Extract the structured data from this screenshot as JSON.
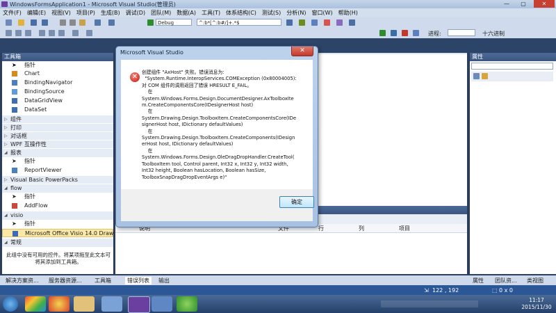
{
  "window": {
    "title": "WindowsFormsApplication1 - Microsoft Visual Studio(管理员)",
    "minimize": "—",
    "maximize": "▢",
    "close": "✕"
  },
  "menu": [
    "文件(F)",
    "编辑(E)",
    "视图(V)",
    "项目(P)",
    "生成(B)",
    "调试(D)",
    "团队(M)",
    "数据(A)",
    "工具(T)",
    "体系结构(C)",
    "测试(S)",
    "分析(N)",
    "窗口(W)",
    "帮助(H)"
  ],
  "toolbar": {
    "config": "Debug",
    "find": "^:b*[^:b#/]+.*$",
    "hex": "十六进制",
    "progress": "进程:"
  },
  "toolbox": {
    "title": "工具箱",
    "items": [
      {
        "label": "指针",
        "icon": "pointer-icon"
      },
      {
        "label": "Chart",
        "icon": "chart-icon"
      },
      {
        "label": "BindingNavigator",
        "icon": "binding-navigator-icon"
      },
      {
        "label": "BindingSource",
        "icon": "binding-source-icon"
      },
      {
        "label": "DataGridView",
        "icon": "datagridview-icon"
      },
      {
        "label": "DataSet",
        "icon": "dataset-icon"
      }
    ],
    "groups_collapsed": [
      "组件",
      "打印",
      "对话框",
      "WPF 互操作性"
    ],
    "report_group": "报表",
    "report_items": [
      "指针",
      "ReportViewer"
    ],
    "vb_group": "Visual Basic PowerPacks",
    "flow_group": "flow",
    "flow_items": [
      "指针",
      "AddFlow"
    ],
    "visio_group": "visio",
    "visio_items": [
      "指针",
      "Microsoft Office Visio 14.0 Drawin..."
    ],
    "general_group": "常规",
    "empty_note_line1": "此组中没有可用的控件。将某项拖至此文本可",
    "empty_note_line2": "将其添加到工具箱。"
  },
  "dialog": {
    "title": "Microsoft Visual Studio",
    "close": "✕",
    "message": "创建组件 \"AxHost\" 失败。错误消息为:\n  \"System.Runtime.InteropServices.COMException (0x80004005):\n对 COM 组件的调用返回了错误 HRESULT E_FAIL。\n    在\nSystem.Windows.Forms.Design.DocumentDesigner.AxToolboxIte\nm.CreateComponentsCore(IDesignerHost host)\n    在\nSystem.Drawing.Design.ToolboxItem.CreateComponentsCore(IDe\nsignerHost host, IDictionary defaultValues)\n    在\nSystem.Drawing.Design.ToolboxItem.CreateComponents(IDesign\nerHost host, IDictionary defaultValues)\n    在\nSystem.Windows.Forms.Design.OleDragDropHandler.CreateTool(\nToolboxItem tool, Control parent, Int32 x, Int32 y, Int32 width,\nInt32 height, Boolean hasLocation, Boolean hasSize,\nToolboxSnapDragDropEventArgs e)\"",
    "ok": "确定"
  },
  "error_list": {
    "columns": [
      "说明",
      "文件",
      "行",
      "列",
      "项目"
    ]
  },
  "properties": {
    "title": "属性"
  },
  "bottom_tabs": [
    "解决方案资...",
    "服务器资源...",
    "工具箱",
    "错误列表",
    "输出",
    "属性",
    "团队资...",
    "类视图"
  ],
  "status": {
    "position": "122 , 192",
    "size": "0 x 0"
  },
  "clock": {
    "time": "11:17",
    "date": "2015/11/30"
  }
}
